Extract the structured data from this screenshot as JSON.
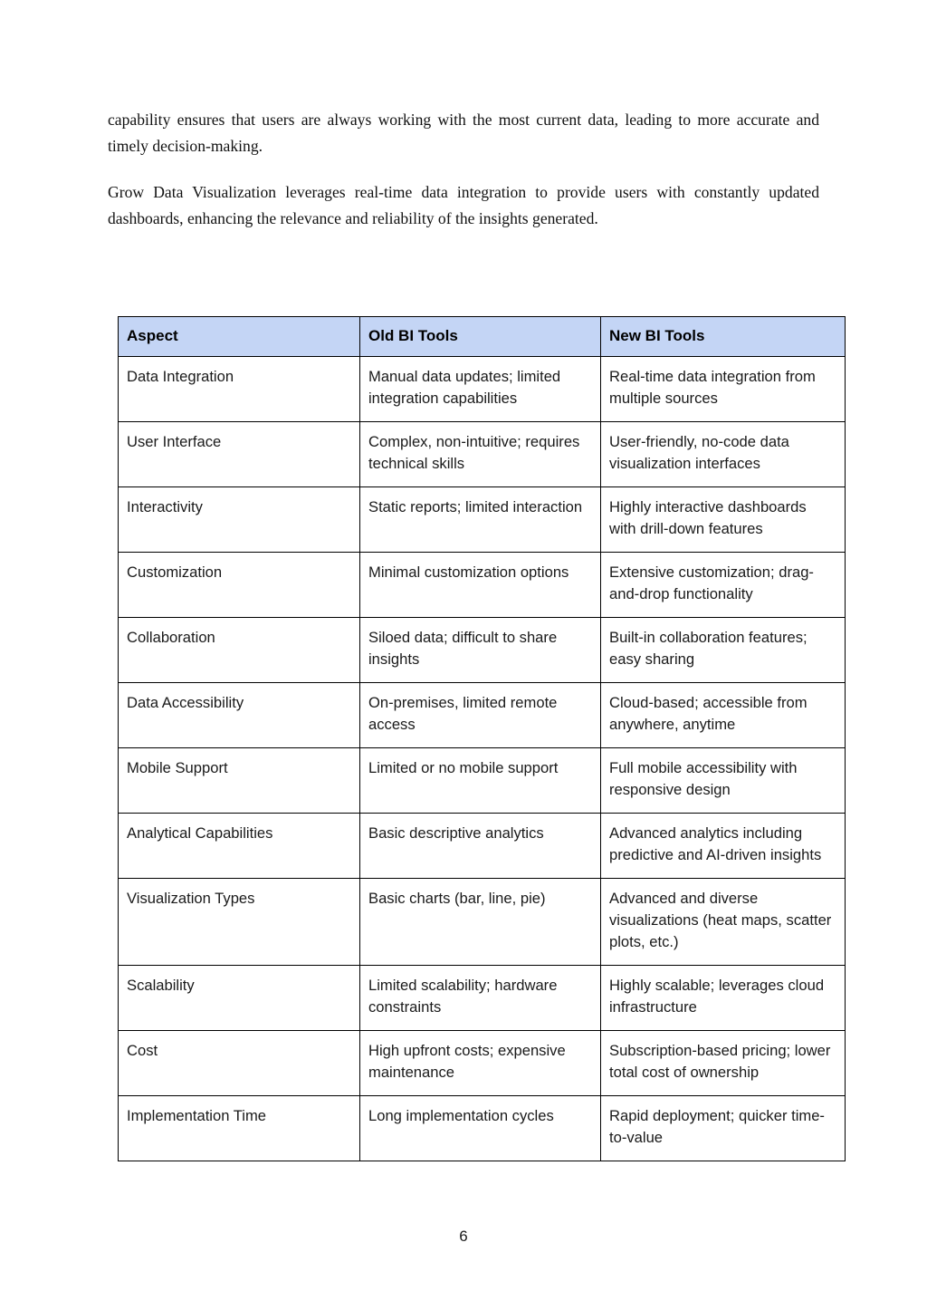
{
  "document": {
    "page_number": "6"
  },
  "prose": {
    "paragraphs": [
      "capability ensures that users are always working with the most current data, leading to more accurate and timely decision-making.",
      "Grow Data Visualization leverages real-time data integration to provide users with constantly updated dashboards, enhancing the relevance and reliability of the insights generated."
    ]
  },
  "table": {
    "header_background": "#c4d5f5",
    "columns": [
      "Aspect",
      "Old BI Tools",
      "New BI Tools"
    ],
    "rows": [
      {
        "aspect": "Data Integration",
        "old": "Manual data updates; limited integration capabilities",
        "new": "Real-time data integration from multiple sources"
      },
      {
        "aspect": "User Interface",
        "old": "Complex, non-intuitive; requires technical skills",
        "new": "User-friendly, no-code data visualization interfaces"
      },
      {
        "aspect": "Interactivity",
        "old": "Static reports; limited interaction",
        "new": "Highly interactive dashboards with drill-down features"
      },
      {
        "aspect": "Customization",
        "old": "Minimal customization options",
        "new": "Extensive customization; drag-and-drop functionality"
      },
      {
        "aspect": "Collaboration",
        "old": "Siloed data; difficult to share insights",
        "new": "Built-in collaboration features; easy sharing"
      },
      {
        "aspect": "Data Accessibility",
        "old": "On-premises, limited remote access",
        "new": "Cloud-based; accessible from anywhere, anytime"
      },
      {
        "aspect": "Mobile Support",
        "old": "Limited or no mobile support",
        "new": "Full mobile accessibility with responsive design"
      },
      {
        "aspect": "Analytical Capabilities",
        "old": "Basic descriptive analytics",
        "new": "Advanced analytics including predictive and AI-driven insights"
      },
      {
        "aspect": "Visualization Types",
        "old": "Basic charts (bar, line, pie)",
        "new": "Advanced and diverse visualizations (heat maps, scatter plots, etc.)"
      },
      {
        "aspect": "Scalability",
        "old": "Limited scalability; hardware constraints",
        "new": "Highly scalable; leverages cloud infrastructure"
      },
      {
        "aspect": "Cost",
        "old": "High upfront costs; expensive maintenance",
        "new": "Subscription-based pricing; lower total cost of ownership"
      },
      {
        "aspect": "Implementation Time",
        "old": "Long implementation cycles",
        "new": "Rapid deployment; quicker time-to-value"
      }
    ]
  }
}
